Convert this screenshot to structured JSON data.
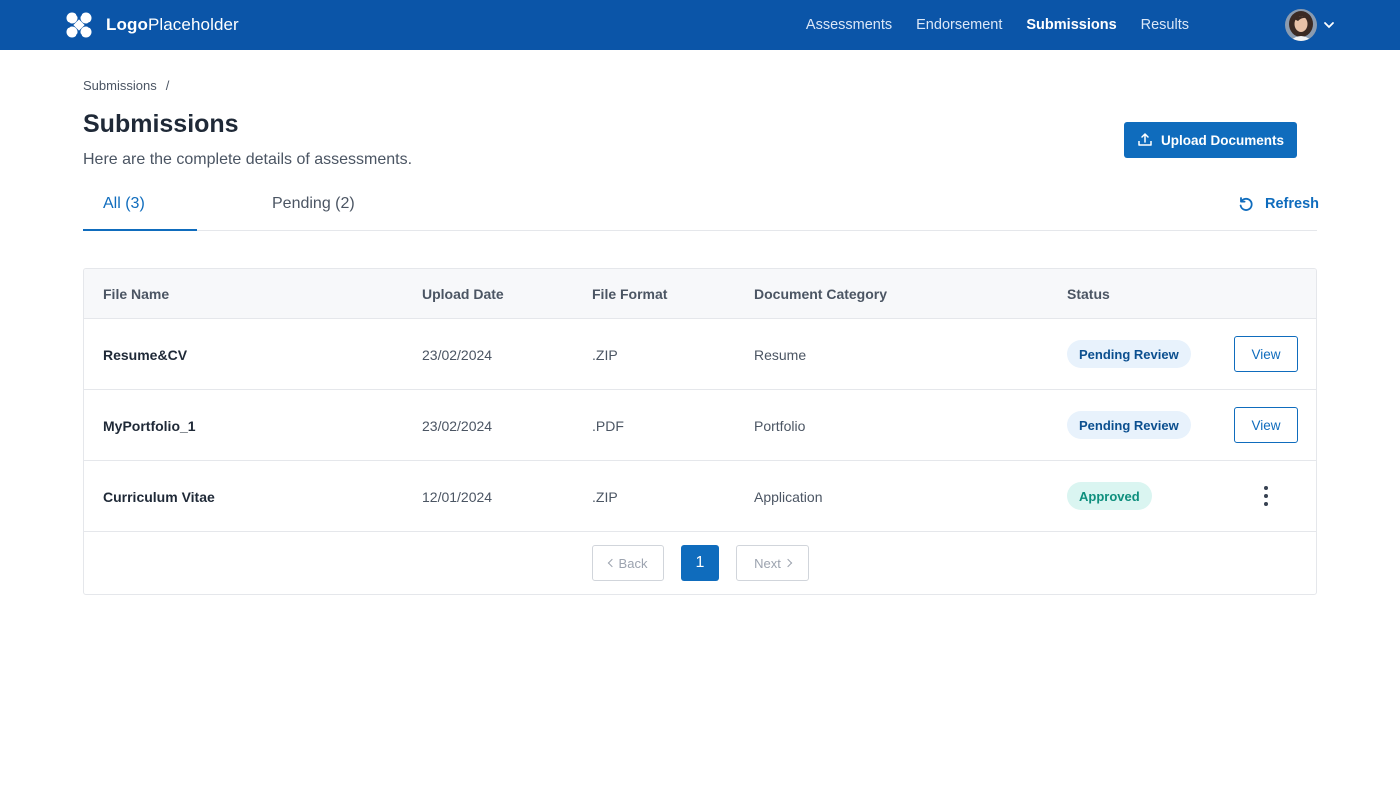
{
  "header": {
    "logo_bold": "Logo",
    "logo_light": "Placeholder",
    "nav": [
      {
        "label": "Assessments"
      },
      {
        "label": "Endorsement"
      },
      {
        "label": "Submissions"
      },
      {
        "label": "Results"
      }
    ],
    "active_nav": "Submissions",
    "brand_color": "#0b55a8"
  },
  "breadcrumb": {
    "item": "Submissions",
    "separator": "/"
  },
  "page": {
    "title": "Submissions",
    "subtitle": "Here are the complete details of assessments.",
    "upload_label": "Upload Documents",
    "refresh_label": "Refresh"
  },
  "tabs": [
    {
      "label": "All (3)"
    },
    {
      "label": "Pending (2)"
    }
  ],
  "active_tab": "All (3)",
  "table": {
    "columns": [
      "File Name",
      "Upload Date",
      "File Format",
      "Document Category",
      "Status"
    ],
    "rows": [
      {
        "file_name": "Resume&CV",
        "upload_date": "23/02/2024",
        "format": ".ZIP",
        "category": "Resume",
        "status": "Pending Review",
        "action": "View"
      },
      {
        "file_name": "MyPortfolio_1",
        "upload_date": "23/02/2024",
        "format": ".PDF",
        "category": "Portfolio",
        "status": "Pending Review",
        "action": "View"
      },
      {
        "file_name": "Curriculum Vitae",
        "upload_date": "12/01/2024",
        "format": ".ZIP",
        "category": "Application",
        "status": "Approved",
        "action": "more-icon"
      }
    ]
  },
  "pagination": {
    "back_label": "Back",
    "next_label": "Next",
    "current_page": "1"
  },
  "colors": {
    "accent": "#0f6cbd",
    "pending_badge": "#e8f2fc",
    "approved_badge": "#daf5f1"
  }
}
